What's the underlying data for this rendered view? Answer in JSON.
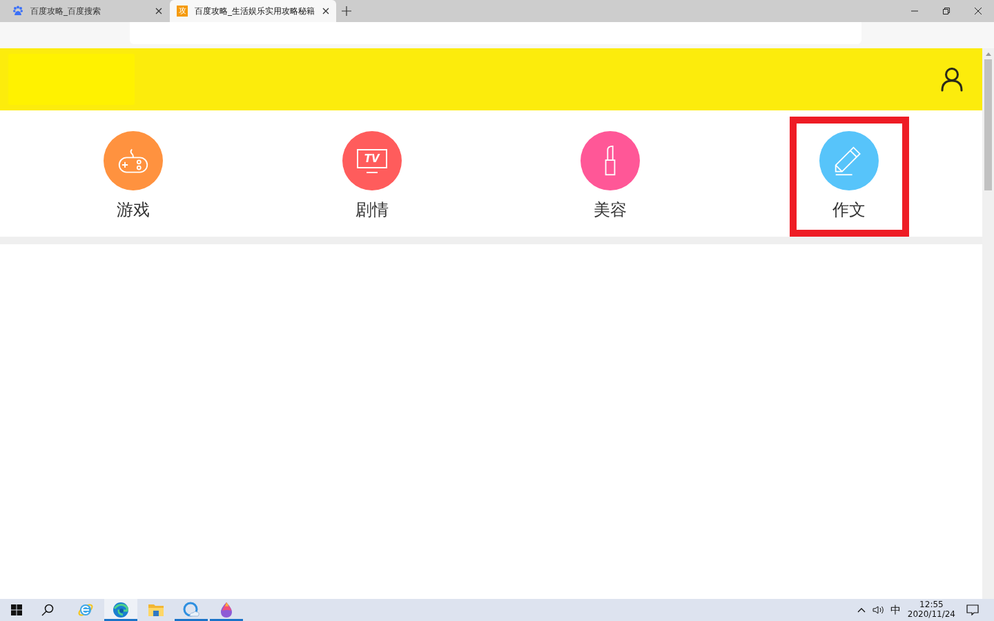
{
  "browser_tabs": [
    {
      "kind": "paw",
      "title": "百度攻略_百度搜索",
      "selected": false
    },
    {
      "kind": "badge",
      "favicon_text": "攻",
      "title": "百度攻略_生活娱乐实用攻略秘籍",
      "selected": true
    }
  ],
  "categories": [
    {
      "kind": "gamepad",
      "label": "游戏",
      "color": "#ff923f",
      "highlighted": false
    },
    {
      "kind": "tv",
      "icon_text": "TV",
      "label": "剧情",
      "color": "#ff5c5c",
      "highlighted": false
    },
    {
      "kind": "lipstick",
      "label": "美容",
      "color": "#ff5797",
      "highlighted": false
    },
    {
      "kind": "pencil",
      "label": "作文",
      "color": "#57c4fa",
      "highlighted": true
    }
  ],
  "taskbar": {
    "apps": [
      {
        "kind": "ie",
        "open": false,
        "active": false
      },
      {
        "kind": "edge",
        "open": true,
        "active": true
      },
      {
        "kind": "folder",
        "open": false,
        "active": false
      },
      {
        "kind": "cloud-q",
        "open": true,
        "active": false
      },
      {
        "kind": "drop",
        "open": true,
        "active": false
      }
    ],
    "ime": "中",
    "time": "12:55",
    "date": "2020/11/24"
  }
}
